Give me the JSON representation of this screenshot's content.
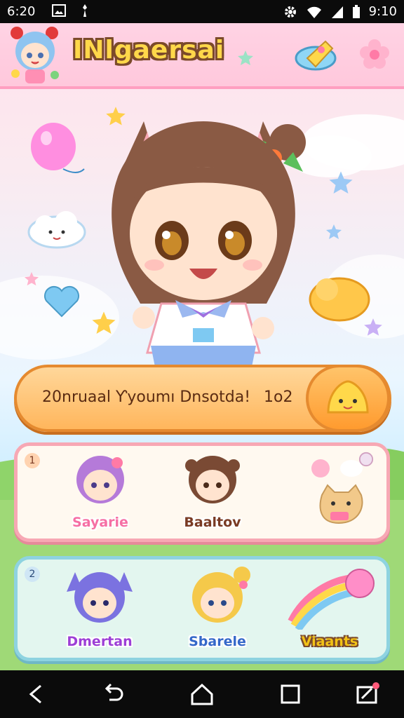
{
  "status_bar": {
    "time_left": "6:20",
    "time_right": "9:10",
    "icons": [
      "gallery-icon",
      "wand-icon",
      "gear-icon",
      "wifi-icon",
      "signal-icon",
      "battery-icon"
    ]
  },
  "header": {
    "title": "INlgaersai",
    "avatar_icon": "chibi-girl-avatar-icon",
    "actions": [
      "rocket-icon",
      "flower-icon"
    ]
  },
  "hero": {
    "character_icon": "chibi-cat-girl-icon"
  },
  "banner": {
    "text": "20nruaal Ƴyoumı Dnsotda!",
    "count": "1o2",
    "mascot_icon": "sun-blob-mascot-icon"
  },
  "cards": [
    {
      "badge": "1",
      "slots": [
        {
          "label": "Sayarie",
          "icon": "purple-hair-girl-icon"
        },
        {
          "label": "Baaltov",
          "icon": "brown-hair-girl-icon"
        },
        {
          "label": "",
          "icon": "shiba-dog-icon"
        }
      ]
    },
    {
      "badge": "2",
      "slots": [
        {
          "label": "Dmertan",
          "icon": "blue-cat-girl-icon"
        },
        {
          "label": "Sbarele",
          "icon": "blonde-girl-icon"
        },
        {
          "label": "Viaants",
          "icon": "rainbow-comet-icon"
        }
      ]
    }
  ],
  "colors": {
    "header_bg": "#ffc8dc",
    "banner_bg": "#ffb65c",
    "card1_border": "#f7a8b4",
    "card2_border": "#8ed3e0",
    "title_fill": "#ffd84a"
  },
  "nav_bar": [
    "back-icon",
    "undo-icon",
    "home-icon",
    "recents-icon",
    "edit-icon"
  ]
}
